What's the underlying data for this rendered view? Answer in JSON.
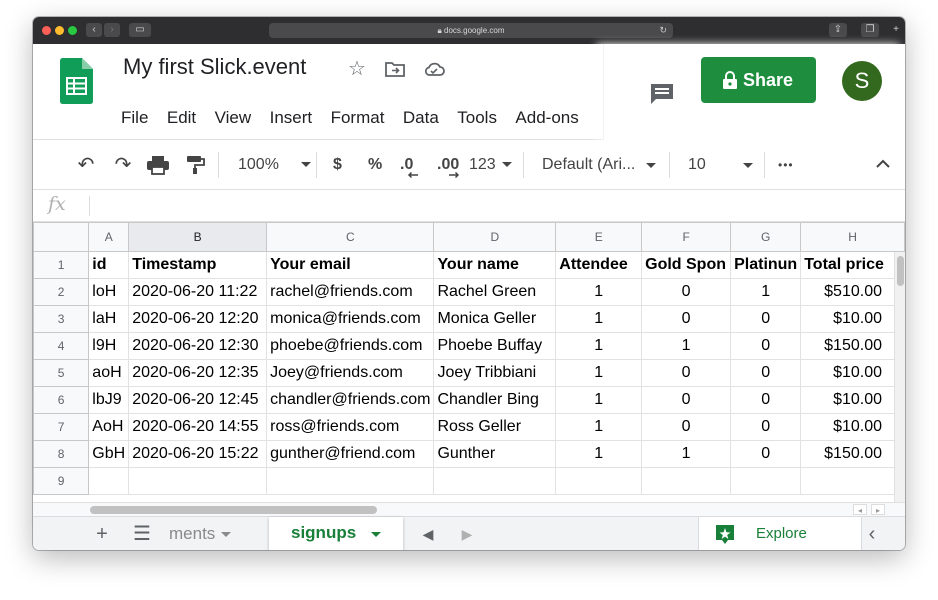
{
  "browser": {
    "url": "docs.google.com"
  },
  "doc": {
    "title": "My first Slick.event",
    "menu": [
      "File",
      "Edit",
      "View",
      "Insert",
      "Format",
      "Data",
      "Tools",
      "Add-ons"
    ]
  },
  "header": {
    "share_label": "Share",
    "avatar_initial": "S"
  },
  "toolbar": {
    "zoom": "100%",
    "currency": "$",
    "percent": "%",
    "decrease_decimal": ".0",
    "increase_decimal": ".00",
    "more_formats": "123",
    "font": "Default (Ari...",
    "font_size": "10",
    "more": "•••"
  },
  "formula_bar": {
    "fx": "fx",
    "value": ""
  },
  "grid": {
    "columns": [
      "A",
      "B",
      "C",
      "D",
      "E",
      "F",
      "G",
      "H"
    ],
    "header_row": [
      "id",
      "Timestamp",
      "Your email",
      "Your name",
      "Attendee",
      "Gold Spon",
      "Platinun",
      "Total price"
    ],
    "rows": [
      [
        "loH",
        "2020-06-20 11:22",
        "rachel@friends.com",
        "Rachel Green",
        "1",
        "0",
        "1",
        "$510.00"
      ],
      [
        "laH",
        "2020-06-20 12:20",
        "monica@friends.com",
        "Monica Geller",
        "1",
        "0",
        "0",
        "$10.00"
      ],
      [
        "l9H",
        "2020-06-20 12:30",
        "phoebe@friends.com",
        "Phoebe Buffay",
        "1",
        "1",
        "0",
        "$150.00"
      ],
      [
        "aoH",
        "2020-06-20 12:35",
        "Joey@friends.com",
        "Joey Tribbiani",
        "1",
        "0",
        "0",
        "$10.00"
      ],
      [
        "lbJ9",
        "2020-06-20 12:45",
        "chandler@friends.com",
        "Chandler Bing",
        "1",
        "0",
        "0",
        "$10.00"
      ],
      [
        "AoH",
        "2020-06-20 14:55",
        "ross@friends.com",
        "Ross Geller",
        "1",
        "0",
        "0",
        "$10.00"
      ],
      [
        "GbH",
        "2020-06-20 15:22",
        "gunther@friend.com",
        "Gunther",
        "1",
        "1",
        "0",
        "$150.00"
      ]
    ],
    "row_numbers": [
      "1",
      "2",
      "3",
      "4",
      "5",
      "6",
      "7",
      "8",
      "9"
    ]
  },
  "tabs": {
    "faded_tab": "ments",
    "active_tab": "signups",
    "explore_label": "Explore"
  },
  "colors": {
    "accent_green": "#1e8e3e",
    "tab_green": "#188038",
    "avatar": "#33691e"
  }
}
